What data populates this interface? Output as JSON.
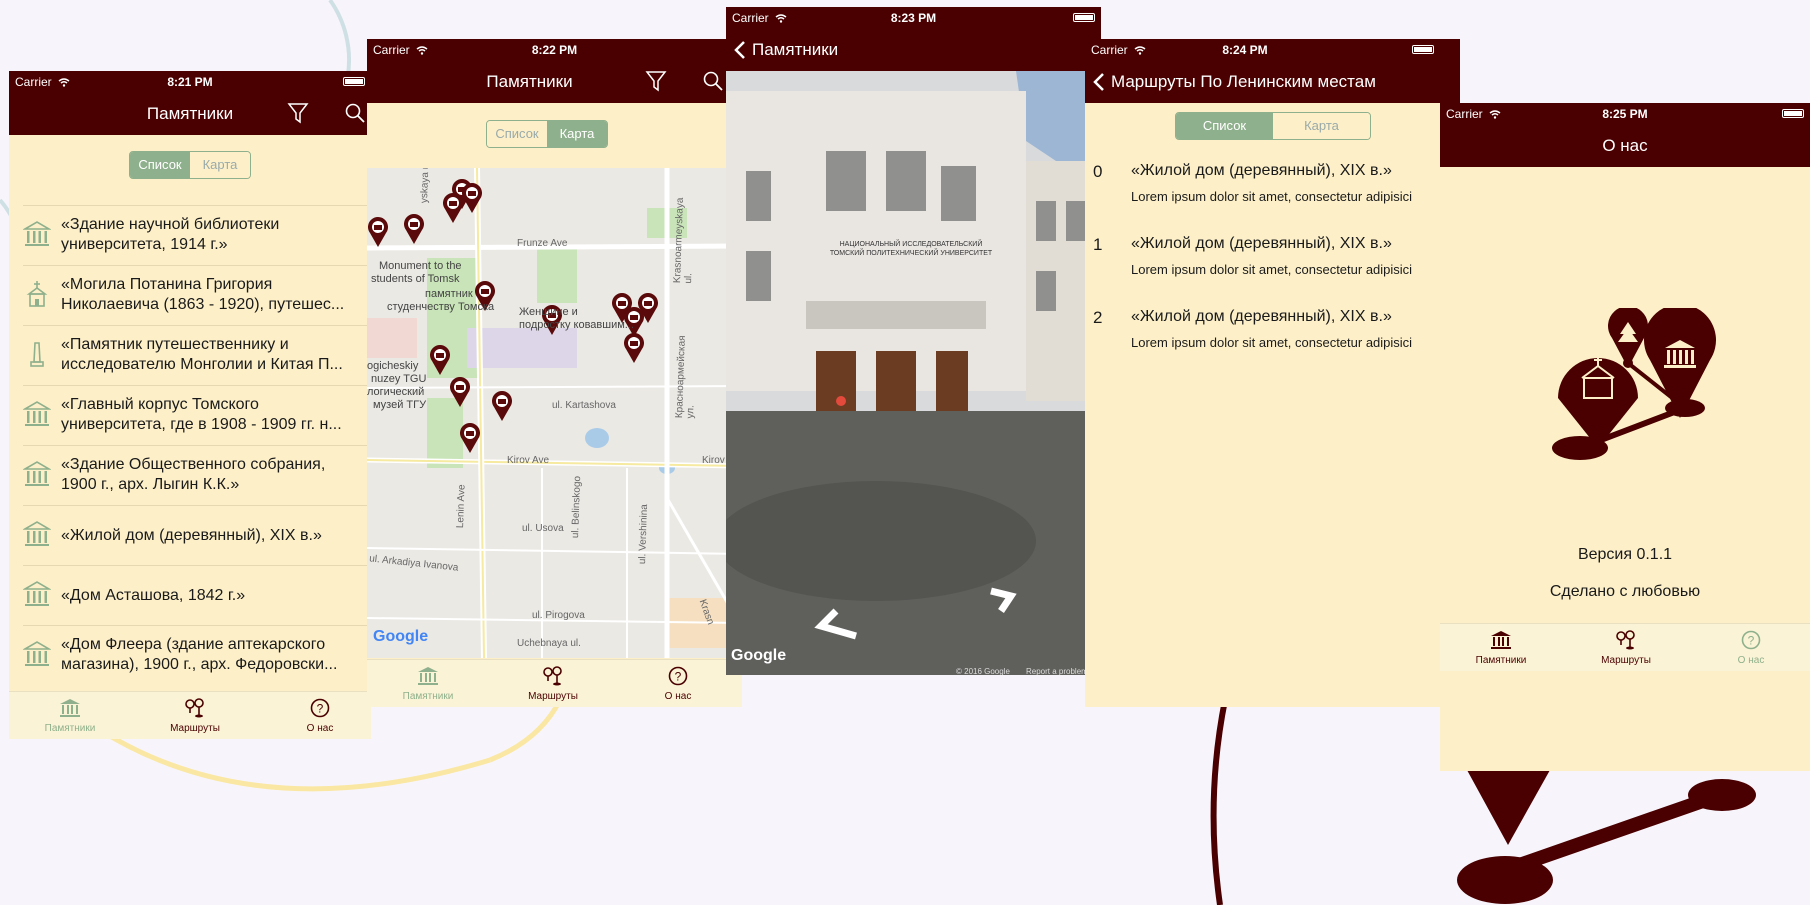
{
  "colors": {
    "brand": "#4a0000",
    "background": "#fdf0c9",
    "accent": "#8fb08c",
    "backdrop": "#f7f5fb"
  },
  "status": {
    "carrier": "Carrier"
  },
  "tabs": {
    "monuments": "Памятники",
    "routes": "Маршруты",
    "about": "О нас"
  },
  "segment": {
    "list": "Список",
    "map": "Карта"
  },
  "screen1": {
    "time": "8:21 PM",
    "title": "Памятники",
    "items": [
      {
        "label": "«Здание научной библиотеки",
        "label2": "университета, 1914 г.»",
        "icon": "museum-icon"
      },
      {
        "label": "«Могила Потанина Григория",
        "label2": "Николаевича (1863 - 1920), путешес...",
        "icon": "chapel-icon"
      },
      {
        "label": "«Памятник путешественнику и",
        "label2": "исследователю Монголии и Китая П...",
        "icon": "obelisk-icon"
      },
      {
        "label": "«Главный корпус Томского",
        "label2": "университета, где в 1908 - 1909 гг. н...",
        "icon": "museum-icon"
      },
      {
        "label": "«Здание Общественного собрания,",
        "label2": "1900 г., арх. Лыгин К.К.»",
        "icon": "museum-icon"
      },
      {
        "label": "«Жилой дом (деревянный), XIX в.»",
        "label2": "",
        "icon": "museum-icon"
      },
      {
        "label": "«Дом Асташова, 1842 г.»",
        "label2": "",
        "icon": "museum-icon"
      },
      {
        "label": "«Дом Флеера (здание аптекарского",
        "label2": "магазина), 1900 г., арх. Федоровски...",
        "icon": "museum-icon"
      }
    ]
  },
  "screen2": {
    "time": "8:22 PM",
    "title": "Памятники",
    "map": {
      "streets": [
        "Frunze Ave",
        "Kirov Ave",
        "Lenin Ave",
        "ul. Kartashova",
        "ul. Usova",
        "ul. Belinskogo",
        "ul. Vershinina",
        "ul. Pirogova",
        "ul. Arkadiya Ivanova",
        "Uchebnaya ul.",
        "Krasnoarmeyskaya ul.",
        "Красноармейская ул.",
        "Kirov",
        "Krasn",
        "yskaya ul."
      ],
      "places": [
        "Monument to the",
        "students of Tomsk",
        "памятник",
        "студенчеству Томска",
        "Женщине и",
        "подростку ковавшим...",
        "ogicheskiy",
        "nuzey TGU",
        "логический",
        "музей ТГУ"
      ],
      "attribution": "Google"
    }
  },
  "screen3": {
    "time": "8:23 PM",
    "back": "Памятники",
    "attribution": "Google",
    "copyright": "© 2016 Google",
    "report": "Report a problem",
    "facade1": "НАЦИОНАЛЬНЫЙ ИССЛЕДОВАТЕЛЬСКИЙ",
    "facade2": "ТОМСКИЙ ПОЛИТЕХНИЧЕСКИЙ УНИВЕРСИТЕТ"
  },
  "screen4": {
    "time": "8:24 PM",
    "title": "Маршруты По Ленинским местам",
    "rows": [
      {
        "n": "0",
        "title": "«Жилой дом (деревянный), XIX в.»",
        "desc": "Lorem ipsum dolor sit amet, consectetur adipisici"
      },
      {
        "n": "1",
        "title": "«Жилой дом (деревянный), XIX в.»",
        "desc": "Lorem ipsum dolor sit amet, consectetur adipisici"
      },
      {
        "n": "2",
        "title": "«Жилой дом (деревянный), XIX в.»",
        "desc": "Lorem ipsum dolor sit amet, consectetur adipisici"
      }
    ]
  },
  "screen5": {
    "time": "8:25 PM",
    "title": "О нас",
    "version": "Версия 0.1.1",
    "made": "Сделано с любовью"
  }
}
